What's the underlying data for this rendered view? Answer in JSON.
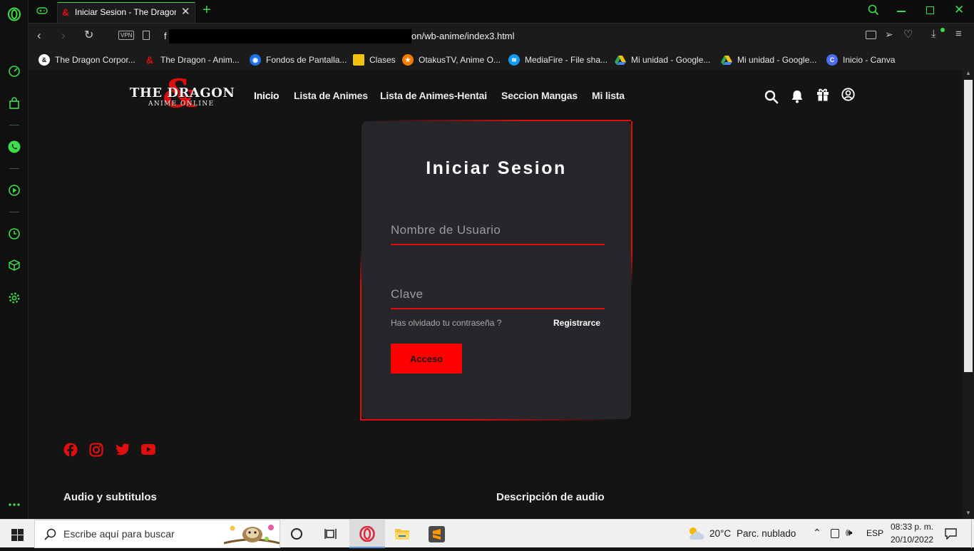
{
  "browser": {
    "tab_title": "Iniciar Sesion - The Dragon",
    "vpn_label": "VPN",
    "url_prefix": "f",
    "url_suffix": "on/wb-anime/index3.html"
  },
  "bookmarks": [
    {
      "label": "The Dragon Corpor...",
      "icon": "dragon-logo-icon",
      "color": "#ffffff"
    },
    {
      "label": "The Dragon - Anim...",
      "icon": "dragon-red-icon",
      "color": "#e01010"
    },
    {
      "label": "Fondos de Pantalla...",
      "icon": "eye-icon",
      "color": "#1a73e8"
    },
    {
      "label": "Clases",
      "icon": "classroom-icon",
      "color": "#f4c20d"
    },
    {
      "label": "OtakusTV, Anime O...",
      "icon": "dragonball-icon",
      "color": "#f57c00"
    },
    {
      "label": "MediaFire - File sha...",
      "icon": "mediafire-icon",
      "color": "#1299f3"
    },
    {
      "label": "Mi unidad - Google...",
      "icon": "drive-icon",
      "color": "#34a853"
    },
    {
      "label": "Mi unidad - Google...",
      "icon": "drive-icon",
      "color": "#34a853"
    },
    {
      "label": "Inicio - Canva",
      "icon": "canva-icon",
      "color": "#00c4cc"
    }
  ],
  "site": {
    "logo_top": "THE DRAGON",
    "logo_sub": "ANIME ONLINE",
    "nav": [
      "Inicio",
      "Lista de Animes",
      "Lista de Animes-Hentai",
      "Seccion Mangas",
      "Mi lista"
    ],
    "accent": "#ff0000"
  },
  "login": {
    "title": "Iniciar Sesion",
    "username_placeholder": "Nombre de Usuario",
    "password_placeholder": "Clave",
    "forgot_text": "Has olvidado tu contraseña ?",
    "register_text": "Registrarce",
    "submit_label": "Acceso"
  },
  "footer": {
    "social": [
      "facebook-icon",
      "instagram-icon",
      "twitter-icon",
      "youtube-icon"
    ],
    "col1_heading": "Audio y subtitulos",
    "col2_heading": "Descripción de audio"
  },
  "taskbar": {
    "search_placeholder": "Escribe aquí para buscar",
    "weather_temp": "20°C",
    "weather_desc": "Parc. nublado",
    "language": "ESP",
    "time": "08:33 p. m.",
    "date": "20/10/2022"
  }
}
